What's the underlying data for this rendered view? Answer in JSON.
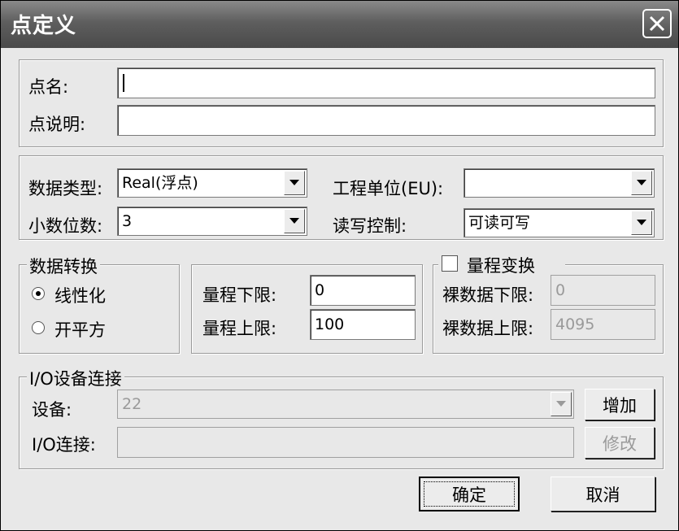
{
  "title": "点定义",
  "icons": {
    "close": "close-icon",
    "dropdown": "chevron-down-icon"
  },
  "point": {
    "name_label": "点名:",
    "name_value": "",
    "desc_label": "点说明:",
    "desc_value": ""
  },
  "data": {
    "type_label": "数据类型:",
    "type_value": "Real(浮点)",
    "decimals_label": "小数位数:",
    "decimals_value": "3",
    "unit_label": "工程单位(EU):",
    "unit_value": "",
    "rw_label": "读写控制:",
    "rw_value": "可读可写"
  },
  "conversion": {
    "legend": "数据转换",
    "linear_label": "线性化",
    "linear_checked": true,
    "sqrt_label": "开平方",
    "sqrt_checked": false
  },
  "range": {
    "low_label": "量程下限:",
    "low_value": "0",
    "high_label": "量程上限:",
    "high_value": "100"
  },
  "transform": {
    "legend": "量程变换",
    "checked": false,
    "raw_low_label": "裸数据下限:",
    "raw_low_value": "0",
    "raw_high_label": "裸数据上限:",
    "raw_high_value": "4095"
  },
  "io": {
    "legend": "I/O设备连接",
    "device_label": "设备:",
    "device_value": "22",
    "conn_label": "I/O连接:",
    "conn_value": "",
    "add_label": "增加",
    "modify_label": "修改"
  },
  "footer": {
    "ok_label": "确定",
    "cancel_label": "取消"
  }
}
